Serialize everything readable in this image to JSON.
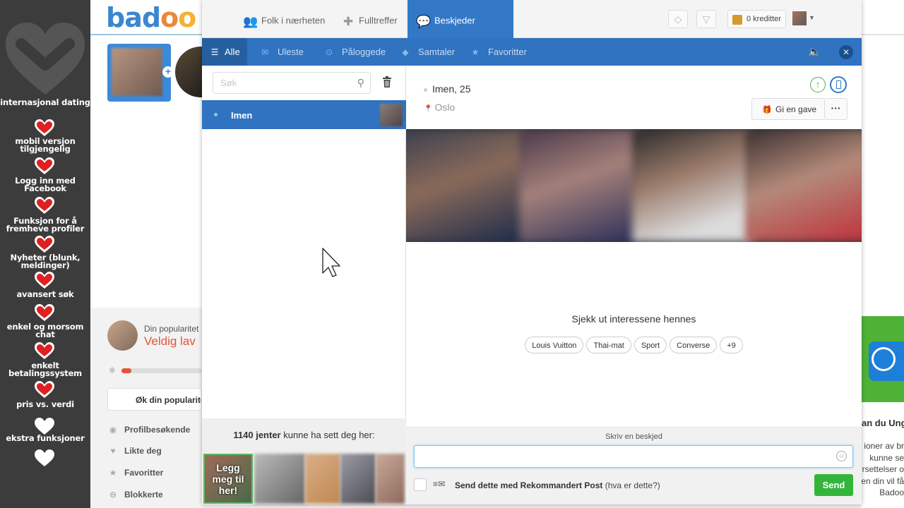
{
  "overlay": {
    "features": [
      "internasjonal dating",
      "mobil versjon tilgjengelig",
      "Logg inn med Facebook",
      "Funksjon for å fremheve profiler",
      "Nyheter (blunk, meldinger)",
      "avansert søk",
      "enkel og morsom chat",
      "enkelt betalingssystem",
      "pris vs. verdi",
      "ekstra funksjoner"
    ],
    "heart_colors": [
      "red",
      "red",
      "red",
      "red",
      "red",
      "red",
      "red",
      "red",
      "white",
      "white",
      "white"
    ]
  },
  "site": {
    "logo": {
      "b": "bad",
      "o1": "o",
      "o2": "o"
    },
    "popularity_label": "Din popularitet",
    "popularity_value": "Veldig lav",
    "popularity_fraction": 0.12,
    "increase_button": "Øk din popularitet",
    "links": [
      "Profilbesøkende",
      "Likte deg",
      "Favoritter",
      "Blokkerte"
    ],
    "right_title": "an du Ung",
    "right_text": [
      "ioner av br",
      "kunne se",
      "rsettelser o",
      "len din vil få",
      "Badoo"
    ]
  },
  "topnav": {
    "tabs": [
      "Folk i nærheten",
      "Fulltreffer",
      "Beskjeder"
    ],
    "active": "Beskjeder",
    "credits": "0 kreditter"
  },
  "subnav": {
    "tabs": [
      "Alle",
      "Uleste",
      "Påloggede",
      "Samtaler",
      "Favoritter"
    ],
    "active": "Alle"
  },
  "conversations": {
    "search_placeholder": "Søk",
    "items": [
      {
        "name": "Imen",
        "selected": true
      }
    ],
    "seen_count": "1140 jenter",
    "seen_text": " kunne ha sett deg her:",
    "add_me": "Legg meg til her!"
  },
  "profile": {
    "name_age": "Imen, 25",
    "city": "Oslo",
    "gift_button": "Gi en gave",
    "more_button": "···",
    "interests_title": "Sjekk ut interessene hennes",
    "interests": [
      "Louis Vuitton",
      "Thai-mat",
      "Sport",
      "Converse",
      "+9"
    ]
  },
  "composer": {
    "label": "Skriv en beskjed",
    "placeholder": "",
    "recommended_bold": "Send dette med Rekommandert Post",
    "recommended_hint": " (hva er dette?)",
    "send_label": "Send"
  },
  "colors": {
    "brand_blue": "#2f73c1",
    "send_green": "#33b53c",
    "popularity_red": "#e4543a",
    "overlay_bg": "#3c3c3c"
  }
}
